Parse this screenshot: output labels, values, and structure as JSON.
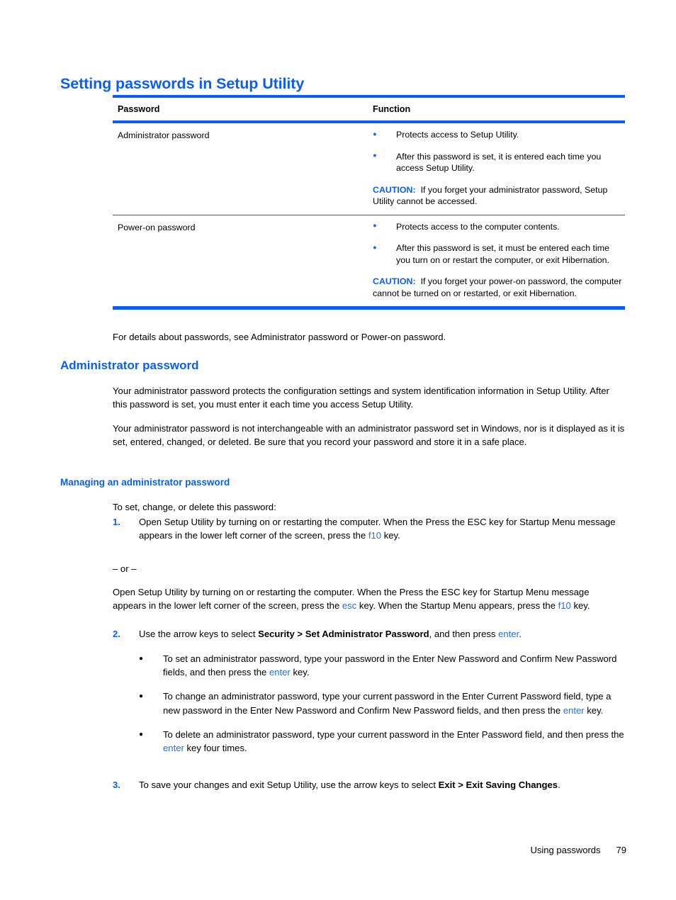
{
  "page": {
    "heading": "Setting passwords in Setup Utility",
    "footer_section": "Using passwords",
    "page_number": "79",
    "accent_blue": "#0b5ef4",
    "link_blue": "#2a6fdb"
  },
  "table": {
    "headers": {
      "password": "Password",
      "function": "Function"
    },
    "rows": [
      {
        "password": "Administrator password",
        "bullets": [
          "Protects access to Setup Utility.",
          "After this password is set, it is entered each time you access Setup Utility."
        ],
        "caution_label": "CAUTION:",
        "caution_text": "If you forget your administrator password, Setup Utility cannot be accessed."
      },
      {
        "password": "Power-on password",
        "bullets": [
          "Protects access to the computer contents.",
          "After this password is set, it must be entered each time you turn on or restart the computer, or exit Hibernation."
        ],
        "caution_label": "CAUTION:",
        "caution_text": "If you forget your power-on password, the computer cannot be turned on or restarted, or exit Hibernation."
      }
    ]
  },
  "content": {
    "intro": "For details about passwords, see Administrator password or Power-on password.",
    "admin_heading": "Administrator password",
    "admin_para_1": "Your administrator password protects the configuration settings and system identification information in Setup Utility. After this password is set, you must enter it each time you access Setup Utility.",
    "admin_para_2": "Your administrator password is not interchangeable with an administrator password set in Windows, nor is it displayed as it is set, entered, changed, or deleted. Be sure that you record your password and store it in a safe place.",
    "managing_heading": "Managing an administrator password",
    "to_set_line": "To set, change, or delete this password:",
    "or_divider": "– or –",
    "step1": {
      "number": "1.",
      "text_before_key": "Open Setup Utility by turning on or restarting the computer. When the Press the ESC key for Startup Menu message appears in the lower left corner of the screen, press the ",
      "key": "f10",
      "text_after_key": " key."
    },
    "alt_step": {
      "part1": "Open Setup Utility by turning on or restarting the computer. When the Press the ESC key for Startup Menu message appears in the lower left corner of the screen, press the ",
      "key1": "esc",
      "part2": " key. When the Startup Menu appears, press the ",
      "key2": "f10",
      "part3": " key."
    },
    "step2": {
      "number": "2.",
      "part1": "Use the arrow keys to select ",
      "bold": "Security > Set Administrator Password",
      "part2": ", and then press ",
      "key": "enter",
      "part3": "."
    },
    "sub_bullets": [
      {
        "part1": "To set an administrator password, type your password in the Enter New Password and Confirm New Password fields, and then press the ",
        "key": "enter",
        "part2": " key."
      },
      {
        "part1": "To change an administrator password, type your current password in the Enter Current Password field, type a new password in the Enter New Password and Confirm New Password fields, and then press the ",
        "key": "enter",
        "part2": " key."
      },
      {
        "part1": "To delete an administrator password, type your current password in the Enter Password field, and then press the ",
        "key": "enter",
        "part2": " key four times."
      }
    ],
    "step3": {
      "number": "3.",
      "part1": "To save your changes and exit Setup Utility, use the arrow keys to select ",
      "bold1": "Exit > Exit Saving Changes",
      "part2": "."
    }
  }
}
